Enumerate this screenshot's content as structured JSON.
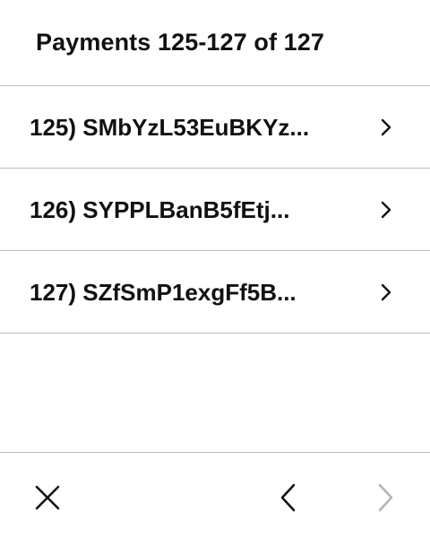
{
  "header": {
    "title": "Payments 125-127 of 127"
  },
  "payments": [
    {
      "label": "125) SMbYzL53EuBKYz..."
    },
    {
      "label": "126) SYPPLBanB5fEtj..."
    },
    {
      "label": "127) SZfSmP1exgFf5B..."
    }
  ],
  "footer": {
    "close_icon": "close-icon",
    "prev_icon": "chevron-left-icon",
    "next_icon": "chevron-right-icon",
    "next_enabled": false
  },
  "colors": {
    "text": "#111111",
    "divider": "#bdbdbd",
    "disabled": "#b5b5b5",
    "background": "#ffffff"
  }
}
